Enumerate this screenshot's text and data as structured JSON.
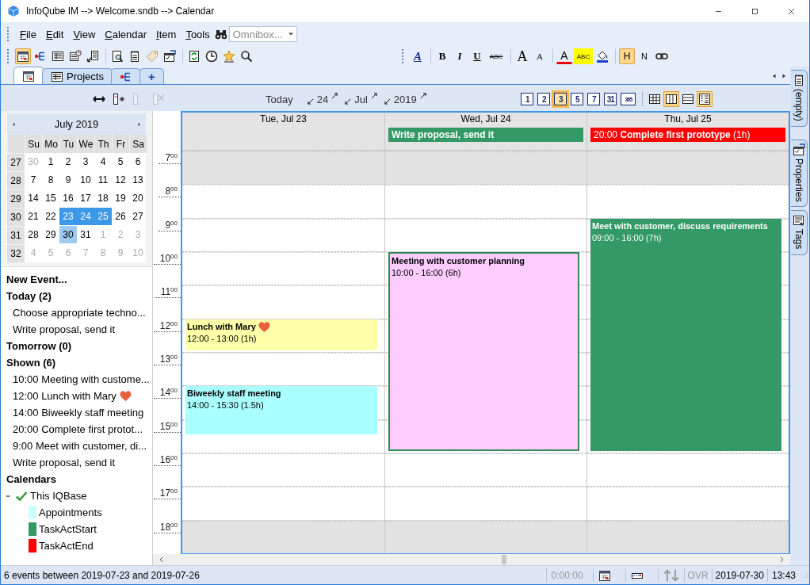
{
  "window": {
    "title": "InfoQube IM --> Welcome.sndb --> Calendar"
  },
  "menu": [
    "File",
    "Edit",
    "View",
    "Calendar",
    "Item",
    "Tools"
  ],
  "omnibox": {
    "placeholder": "Omnibox..."
  },
  "toolbar": [
    {
      "kind": "calendar",
      "selected": true
    },
    {
      "kind": "outline",
      "selected": false
    },
    {
      "kind": "grid",
      "selected": false
    },
    {
      "kind": "schedule",
      "selected": false
    },
    {
      "kind": "export",
      "selected": false
    },
    {
      "kind": "preview",
      "selected": false
    },
    {
      "kind": "notes",
      "selected": false
    },
    {
      "kind": "tag",
      "selected": false
    },
    {
      "kind": "properties",
      "selected": false
    },
    {
      "kind": "sync",
      "selected": false
    },
    {
      "kind": "history",
      "selected": false
    },
    {
      "kind": "favorites",
      "selected": false
    },
    {
      "kind": "search",
      "selected": false
    }
  ],
  "format_toolbar": [
    {
      "kind": "style",
      "label": "A",
      "selected": false
    },
    {
      "kind": "bold",
      "label": "B",
      "selected": false
    },
    {
      "kind": "italic",
      "label": "I",
      "selected": false
    },
    {
      "kind": "underline",
      "label": "U",
      "selected": false
    },
    {
      "kind": "strike",
      "label": "ABC",
      "selected": false
    },
    {
      "kind": "grow",
      "label": "A",
      "selected": false
    },
    {
      "kind": "shrink",
      "label": "A",
      "selected": false
    },
    {
      "kind": "color",
      "label": "A",
      "selected": false
    },
    {
      "kind": "highlight",
      "label": "ABC",
      "selected": false
    },
    {
      "kind": "fill",
      "selected": false
    },
    {
      "kind": "heading",
      "label": "H",
      "selected": true
    },
    {
      "kind": "normal",
      "label": "N",
      "selected": false
    },
    {
      "kind": "link",
      "selected": false
    }
  ],
  "tabs": [
    {
      "kind": "calendar",
      "selected": true
    },
    {
      "kind": "grid",
      "label": "Projects",
      "selected": false
    },
    {
      "kind": "outline",
      "selected": false
    },
    {
      "kind": "add",
      "label": "+",
      "selected": false
    }
  ],
  "calendar_nav": {
    "tools": [
      {
        "kind": "width",
        "disabled": false
      },
      {
        "kind": "add_column",
        "disabled": false
      },
      {
        "kind": "column",
        "disabled": true
      },
      {
        "kind": "remove_column",
        "disabled": true
      }
    ],
    "today": "Today",
    "day": "24",
    "month": "Jul",
    "year": "2019",
    "views": [
      {
        "label": "1",
        "selected": false
      },
      {
        "label": "2",
        "selected": false
      },
      {
        "label": "3",
        "selected": true
      },
      {
        "label": "5",
        "selected": false
      },
      {
        "label": "7",
        "selected": false
      },
      {
        "label": "31",
        "selected": false
      },
      {
        "label": "365",
        "selected": false
      }
    ],
    "layouts": [
      {
        "kind": "grid",
        "selected": false
      },
      {
        "kind": "columns",
        "selected": true
      },
      {
        "kind": "rows",
        "selected": false
      },
      {
        "kind": "list",
        "selected": true
      }
    ]
  },
  "mini_calendar": {
    "title": "July 2019",
    "weekdays": [
      "Su",
      "Mo",
      "Tu",
      "We",
      "Th",
      "Fr",
      "Sa"
    ],
    "weeks": [
      {
        "number": "27",
        "days": [
          {
            "label": "30",
            "outside": true,
            "selected": false,
            "today": false
          },
          {
            "label": "1",
            "outside": false,
            "selected": false,
            "today": false
          },
          {
            "label": "2",
            "outside": false,
            "selected": false,
            "today": false
          },
          {
            "label": "3",
            "outside": false,
            "selected": false,
            "today": false
          },
          {
            "label": "4",
            "outside": false,
            "selected": false,
            "today": false
          },
          {
            "label": "5",
            "outside": false,
            "selected": false,
            "today": false
          },
          {
            "label": "6",
            "outside": false,
            "selected": false,
            "today": false
          }
        ]
      },
      {
        "number": "28",
        "days": [
          {
            "label": "7",
            "outside": false,
            "selected": false,
            "today": false
          },
          {
            "label": "8",
            "outside": false,
            "selected": false,
            "today": false
          },
          {
            "label": "9",
            "outside": false,
            "selected": false,
            "today": false
          },
          {
            "label": "10",
            "outside": false,
            "selected": false,
            "today": false
          },
          {
            "label": "11",
            "outside": false,
            "selected": false,
            "today": false
          },
          {
            "label": "12",
            "outside": false,
            "selected": false,
            "today": false
          },
          {
            "label": "13",
            "outside": false,
            "selected": false,
            "today": false
          }
        ]
      },
      {
        "number": "29",
        "days": [
          {
            "label": "14",
            "outside": false,
            "selected": false,
            "today": false
          },
          {
            "label": "15",
            "outside": false,
            "selected": false,
            "today": false
          },
          {
            "label": "16",
            "outside": false,
            "selected": false,
            "today": false
          },
          {
            "label": "17",
            "outside": false,
            "selected": false,
            "today": false
          },
          {
            "label": "18",
            "outside": false,
            "selected": false,
            "today": false
          },
          {
            "label": "19",
            "outside": false,
            "selected": false,
            "today": false
          },
          {
            "label": "20",
            "outside": false,
            "selected": false,
            "today": false
          }
        ]
      },
      {
        "number": "30",
        "days": [
          {
            "label": "21",
            "outside": false,
            "selected": false,
            "today": false
          },
          {
            "label": "22",
            "outside": false,
            "selected": false,
            "today": false
          },
          {
            "label": "23",
            "outside": false,
            "selected": true,
            "today": false
          },
          {
            "label": "24",
            "outside": false,
            "selected": true,
            "today": false
          },
          {
            "label": "25",
            "outside": false,
            "selected": true,
            "today": false
          },
          {
            "label": "26",
            "outside": false,
            "selected": false,
            "today": false
          },
          {
            "label": "27",
            "outside": false,
            "selected": false,
            "today": false
          }
        ]
      },
      {
        "number": "31",
        "days": [
          {
            "label": "28",
            "outside": false,
            "selected": false,
            "today": false
          },
          {
            "label": "29",
            "outside": false,
            "selected": false,
            "today": false
          },
          {
            "label": "30",
            "outside": false,
            "selected": false,
            "today": true
          },
          {
            "label": "31",
            "outside": false,
            "selected": false,
            "today": false
          },
          {
            "label": "1",
            "outside": true,
            "selected": false,
            "today": false
          },
          {
            "label": "2",
            "outside": true,
            "selected": false,
            "today": false
          },
          {
            "label": "3",
            "outside": true,
            "selected": false,
            "today": false
          }
        ]
      },
      {
        "number": "32",
        "days": [
          {
            "label": "4",
            "outside": true,
            "selected": false,
            "today": false
          },
          {
            "label": "5",
            "outside": true,
            "selected": false,
            "today": false
          },
          {
            "label": "6",
            "outside": true,
            "selected": false,
            "today": false
          },
          {
            "label": "7",
            "outside": true,
            "selected": false,
            "today": false
          },
          {
            "label": "8",
            "outside": true,
            "selected": false,
            "today": false
          },
          {
            "label": "9",
            "outside": true,
            "selected": false,
            "today": false
          },
          {
            "label": "10",
            "outside": true,
            "selected": false,
            "today": false
          }
        ]
      }
    ]
  },
  "agenda": {
    "new_event": "New Event...",
    "groups": [
      {
        "title": "Today (2)",
        "items": [
          {
            "text": "Choose appropriate techno..."
          },
          {
            "text": "Write proposal, send it"
          }
        ]
      },
      {
        "title": "Tomorrow (0)"
      },
      {
        "title": "Shown (6)",
        "items": [
          {
            "text": "10:00 Meeting with custome..."
          },
          {
            "text": "12:00 Lunch with Mary",
            "heart": true
          },
          {
            "text": "14:00 Biweekly staff meeting"
          },
          {
            "text": "20:00 Complete first protot..."
          },
          {
            "text": "9:00 Meet with customer, di..."
          },
          {
            "text": "Write proposal, send it"
          }
        ]
      }
    ],
    "calendars": {
      "title": "Calendars",
      "tree": [
        {
          "label": "This IQBase",
          "expanded": true,
          "checked": true,
          "children": [
            {
              "label": "Appointments",
              "color": "#ccffff"
            },
            {
              "label": "TaskActStart",
              "color": "#339966"
            },
            {
              "label": "TaskActEnd",
              "color": "#ff0000"
            }
          ]
        }
      ]
    }
  },
  "day_view": {
    "hours": [
      {
        "label": "7$^{00}$",
        "off": true
      },
      {
        "label": "8$^{00}$",
        "off": false
      },
      {
        "label": "9$^{00}$",
        "off": false
      },
      {
        "label": "10$^{00}$",
        "off": false
      },
      {
        "label": "11$^{00}$",
        "off": false
      },
      {
        "label": "12$^{00}$",
        "off": false
      },
      {
        "label": "13$^{00}$",
        "off": false
      },
      {
        "label": "14$^{00}$",
        "off": false
      },
      {
        "label": "15$^{00}$",
        "off": false
      },
      {
        "label": "16$^{00}$",
        "off": false
      },
      {
        "label": "17$^{00}$",
        "off": false
      },
      {
        "label": "18$^{00}$",
        "off": true
      }
    ],
    "days": [
      {
        "label": "Tue, Jul 23",
        "events": [
          {
            "title": "Lunch with Mary",
            "heart": true,
            "time": "12:00 - 13:00 (1h)",
            "color": "#ffffaa",
            "selected": false
          },
          {
            "title": "Biweekly staff meeting",
            "time": "14:00 - 15:30 (1.5h)",
            "color": "#aaffff",
            "selected": false
          }
        ]
      },
      {
        "label": "Wed, Jul 24",
        "allday": [
          {
            "kind": "task",
            "text": "Write proposal, send it",
            "color": "#339966"
          }
        ],
        "events": [
          {
            "title": "Meeting with customer planning",
            "time": "10:00 - 16:00 (6h)",
            "color": "#ffccff",
            "selected": true
          }
        ]
      },
      {
        "label": "Thu, Jul 25",
        "allday": [
          {
            "kind": "timed",
            "text": "20:00 **Complete first prototype** (1h)",
            "color": "#ff0000"
          }
        ],
        "events": [
          {
            "title": "Meet with customer, discuss requirements",
            "time": "09:00 - 16:00 (7h)",
            "color": "#339966",
            "selected": false
          }
        ]
      }
    ]
  },
  "side_tabs": [
    {
      "kind": "notes",
      "label": "(empty)"
    },
    {
      "kind": "properties",
      "label": "Properties"
    },
    {
      "kind": "tags",
      "label": "Tags"
    }
  ],
  "status": {
    "message": "6 events between 2019-07-23 and 2019-07-26",
    "timer": {
      "text": "0:00:00",
      "disabled": true
    },
    "mode": {
      "text": "OVR",
      "disabled": true
    },
    "date": "2019-07-30",
    "time": "13:43"
  }
}
